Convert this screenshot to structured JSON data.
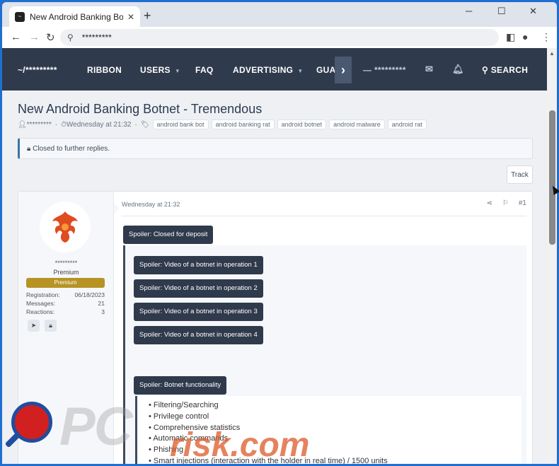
{
  "browser": {
    "tab_title": "New Android Banking Botnet - Tr",
    "url": "*********",
    "new_tab": "+",
    "controls": {
      "minimize": "─",
      "maximize": "☐",
      "close": "✕"
    }
  },
  "site_nav": {
    "logo": "~/*********",
    "items": [
      "RIBBON",
      "USERS",
      "FAQ",
      "ADVERTISING",
      "GUA"
    ],
    "user": "*********",
    "search": "SEARCH"
  },
  "thread": {
    "title": "New Android Banking Botnet - Tremendous",
    "author": "*********",
    "date": "Wednesday at 21:32",
    "tags": [
      "android bank bot",
      "android banking rat",
      "android botnet",
      "android malware",
      "android rat"
    ],
    "closed_notice": "Closed to further replies.",
    "track_label": "Track"
  },
  "post": {
    "username": "*********",
    "user_title": "Premium",
    "badge": "Premium",
    "stats": [
      {
        "label": "Registration:",
        "value": "06/18/2023"
      },
      {
        "label": "Messages:",
        "value": "21"
      },
      {
        "label": "Reactions:",
        "value": "3"
      }
    ],
    "date": "Wednesday at 21:32",
    "number": "#1",
    "spoiler_main": "Spoiler: Closed for deposit",
    "spoilers": [
      "Spoiler: Video of a botnet in operation 1",
      "Spoiler: Video of a botnet in operation 2",
      "Spoiler: Video of a botnet in operation 3",
      "Spoiler: Video of a botnet in operation 4"
    ],
    "spoiler_functionality": "Spoiler: Botnet functionality",
    "features": [
      "Filtering/Searching",
      "Privilege control",
      "Comprehensive statistics",
      "Automatic commands",
      "Phishing",
      "Smart injections (interaction with the holder in real time) / 1500 units"
    ]
  },
  "watermark": {
    "text1": "PC",
    "text2": "risk.com"
  },
  "colors": {
    "nav_bg": "#2f3a4c",
    "badge": "#b69323",
    "spoiler": "#2f3a4c",
    "accent": "#3d71a9"
  }
}
